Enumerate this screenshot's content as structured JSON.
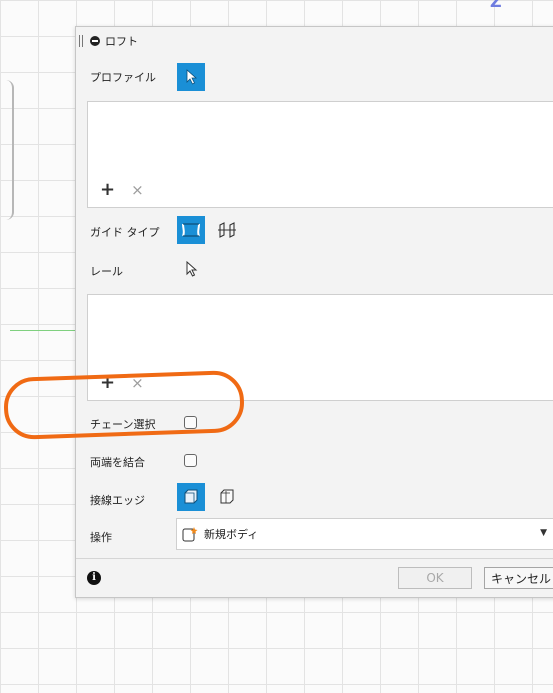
{
  "canvas": {
    "axis_label": "Z"
  },
  "dialog": {
    "title": "ロフト",
    "profile": {
      "label": "プロファイル",
      "tool_icon": "arrow-cursor-icon"
    },
    "profile_list": {
      "add_symbol": "+",
      "remove_symbol": "×"
    },
    "guide_type": {
      "label": "ガイド タイプ",
      "options": [
        "rail-guide-icon",
        "centerline-guide-icon"
      ],
      "selected": "rail-guide-icon"
    },
    "rail": {
      "label": "レール",
      "tool_icon": "arrow-cursor-outline-icon"
    },
    "rail_list": {
      "add_symbol": "+",
      "remove_symbol": "×"
    },
    "chain_selection": {
      "label": "チェーン選択",
      "checked": false
    },
    "merge_ends": {
      "label": "両端を結合",
      "checked": false
    },
    "tangent_edges": {
      "label": "接線エッジ",
      "options": [
        "tangent-merge-icon",
        "tangent-keep-icon"
      ],
      "selected": "tangent-merge-icon"
    },
    "operation": {
      "label": "操作",
      "value": "新規ボディ",
      "icon": "new-body-icon"
    },
    "footer": {
      "info_symbol": "i",
      "ok_label": "OK",
      "cancel_label": "キャンセル"
    }
  },
  "annotation": {
    "color": "#f06a14"
  },
  "colors": {
    "accent": "#1a8fd6",
    "dialog_bg": "#f3f3f3"
  }
}
